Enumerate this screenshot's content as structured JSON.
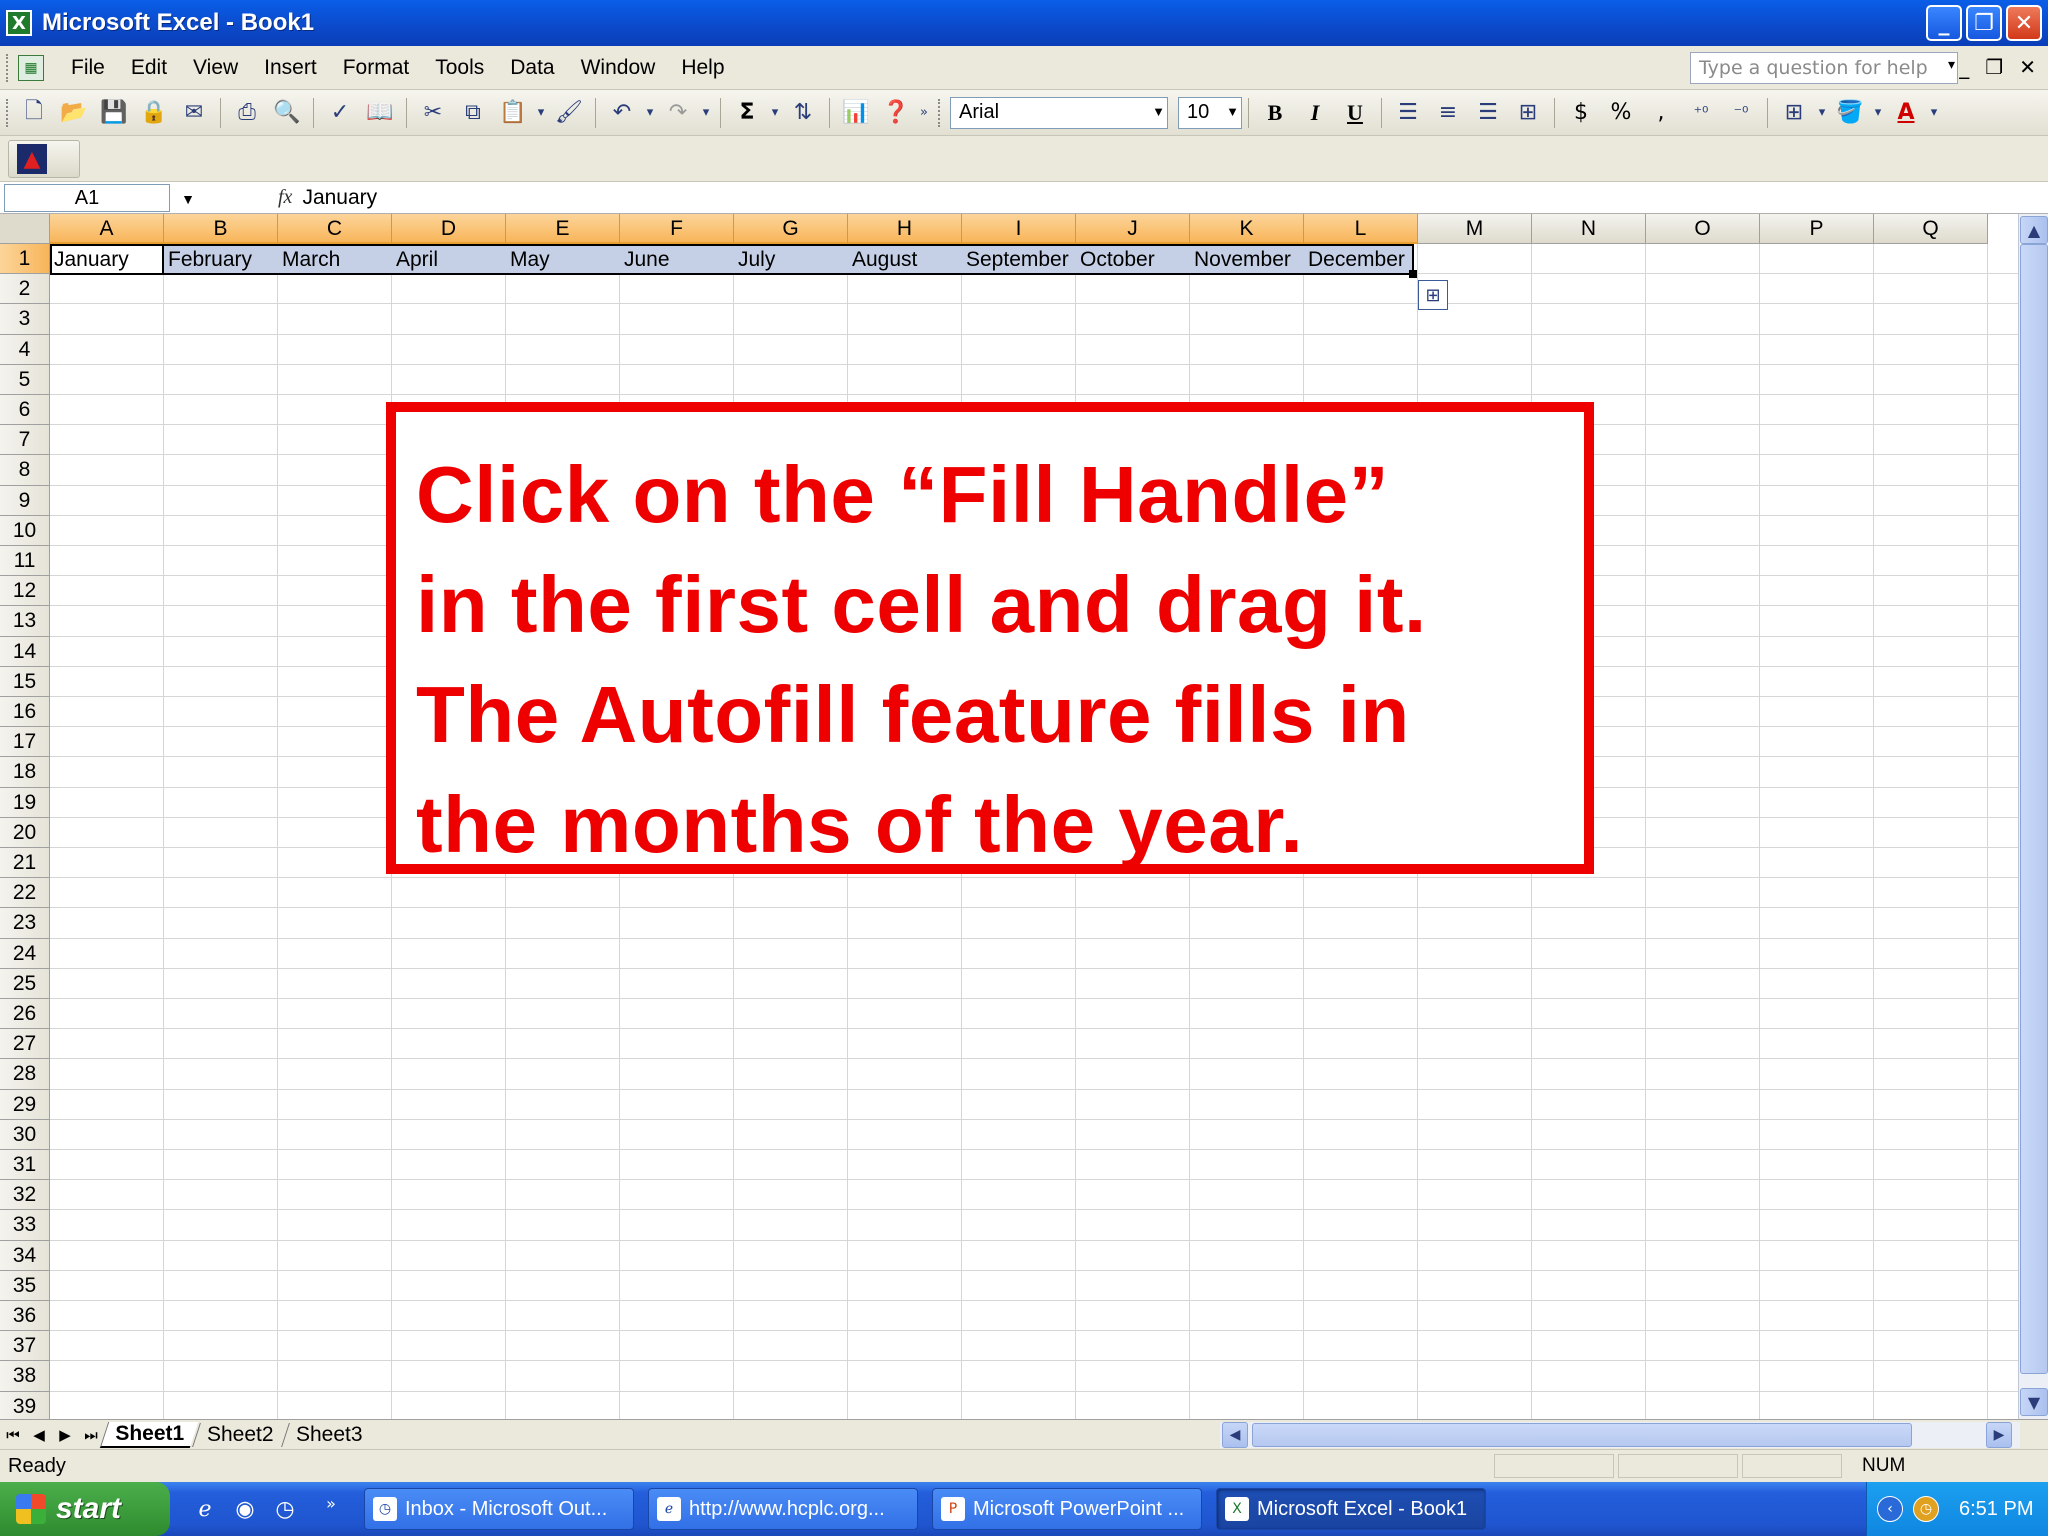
{
  "window": {
    "title": "Microsoft Excel - Book1",
    "minimize": "_",
    "restore": "❐",
    "close": "✕"
  },
  "menu": {
    "items": [
      "File",
      "Edit",
      "View",
      "Insert",
      "Format",
      "Tools",
      "Data",
      "Window",
      "Help"
    ],
    "help_placeholder": "Type a question for help"
  },
  "toolbar": {
    "font": "Arial",
    "font_size": "10",
    "bold": "B",
    "italic": "I",
    "underline": "U",
    "currency": "$",
    "percent": "%",
    "comma": ","
  },
  "formula_bar": {
    "name_box": "A1",
    "fx": "fx",
    "value": "January"
  },
  "grid": {
    "columns": [
      "A",
      "B",
      "C",
      "D",
      "E",
      "F",
      "G",
      "H",
      "I",
      "J",
      "K",
      "L",
      "M",
      "N",
      "O",
      "P",
      "Q"
    ],
    "selected_columns": [
      "A",
      "B",
      "C",
      "D",
      "E",
      "F",
      "G",
      "H",
      "I",
      "J",
      "K",
      "L"
    ],
    "rows": [
      "1",
      "2",
      "3",
      "4",
      "5",
      "6",
      "7",
      "8",
      "9",
      "10",
      "11",
      "12",
      "13",
      "14",
      "15",
      "16",
      "17",
      "18",
      "19",
      "20",
      "21",
      "22",
      "23",
      "24",
      "25",
      "26",
      "27",
      "28",
      "29",
      "30",
      "31",
      "32",
      "33",
      "34",
      "35",
      "36",
      "37",
      "38",
      "39"
    ],
    "row1": [
      "January",
      "February",
      "March",
      "April",
      "May",
      "June",
      "July",
      "August",
      "September",
      "October",
      "November",
      "December"
    ]
  },
  "callout": {
    "lines": [
      "Click on the “Fill Handle”",
      "in the first cell and drag it.",
      "The Autofill feature fills in",
      "the months of the year."
    ],
    "color": "#ee0000"
  },
  "sheets": {
    "tabs": [
      "Sheet1",
      "Sheet2",
      "Sheet3"
    ],
    "active": "Sheet1"
  },
  "status": {
    "ready": "Ready",
    "num": "NUM"
  },
  "taskbar": {
    "start": "start",
    "tasks": [
      "Inbox - Microsoft Out...",
      "http://www.hcplc.org...",
      "Microsoft PowerPoint ...",
      "Microsoft Excel - Book1"
    ],
    "clock": "6:51 PM"
  },
  "colors": {
    "accent": "#0b49c9",
    "selection": "#c5d0e6",
    "header_selected": "#f8b55a",
    "callout_red": "#ee0000"
  }
}
